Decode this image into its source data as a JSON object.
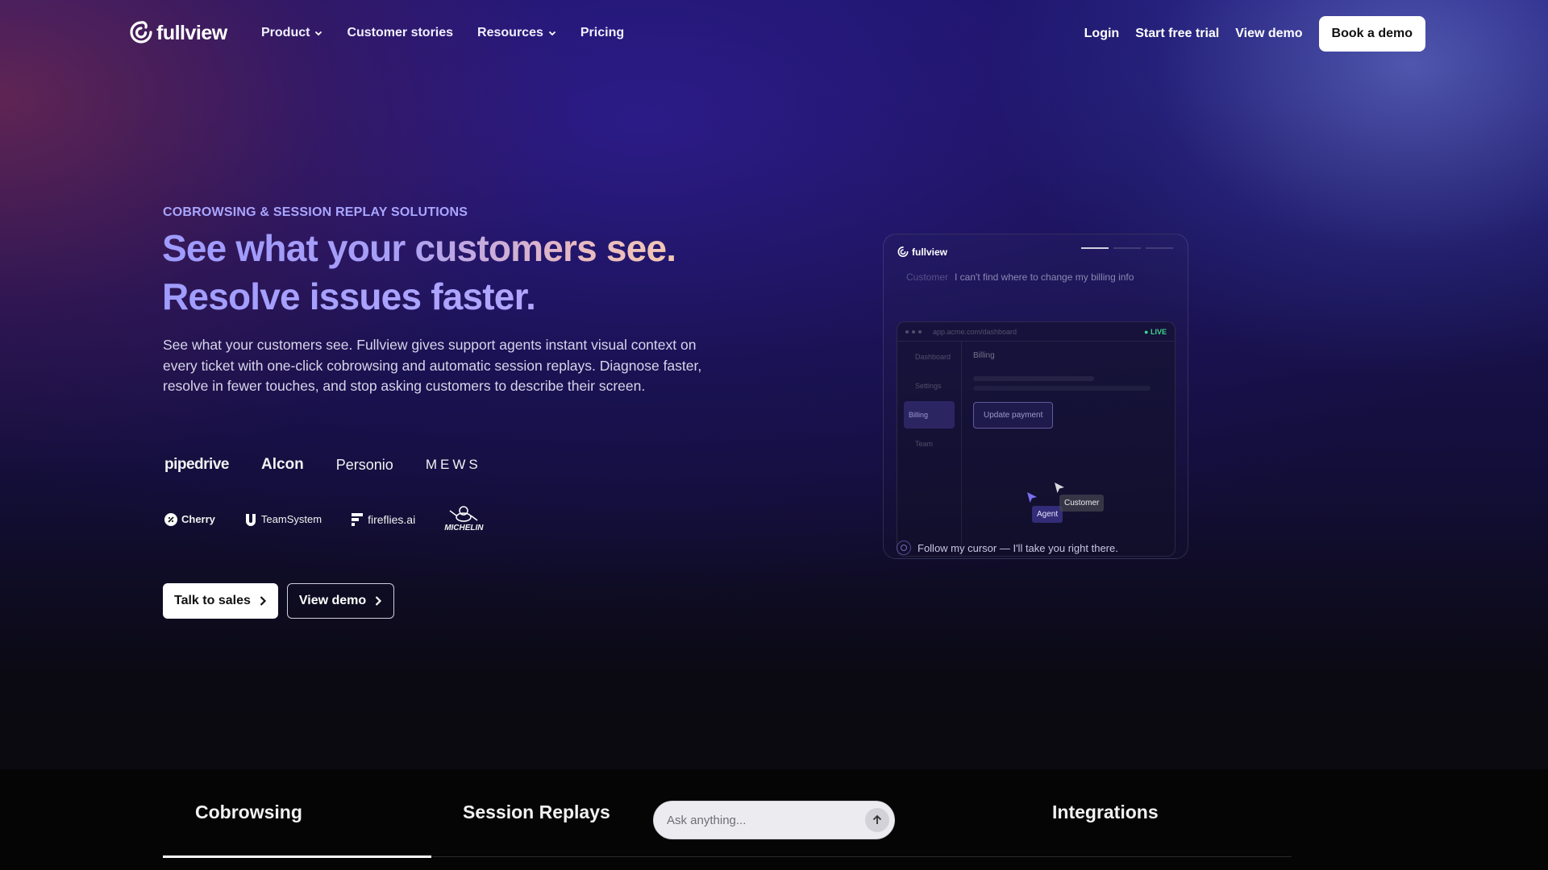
{
  "nav": {
    "brand": "fullview",
    "links": [
      {
        "label": "Product",
        "dropdown": true
      },
      {
        "label": "Customer stories",
        "dropdown": false
      },
      {
        "label": "Resources",
        "dropdown": true
      },
      {
        "label": "Pricing",
        "dropdown": false
      }
    ],
    "login": "Login",
    "trial": "Start free trial",
    "view_demo": "View demo",
    "book_demo": "Book a demo"
  },
  "hero": {
    "eyebrow": "COBROWSING & SESSION REPLAY SOLUTIONS",
    "headline_line1": "See what your customers see.",
    "headline_line2": "Resolve issues faster.",
    "description": "See what your customers see. Fullview gives support agents instant visual context on every ticket with one-click cobrowsing and automatic session replays. Diagnose faster, resolve in fewer touches, and stop asking customers to describe their screen.",
    "logos_row1": [
      "pipedrive",
      "Alcon",
      "Personio",
      "MEWS"
    ],
    "logos_row2": [
      "Cherry",
      "TeamSystem",
      "fireflies.ai",
      "MICHELIN"
    ],
    "cta_primary": "Talk to sales",
    "cta_secondary": "View demo"
  },
  "mock": {
    "brand": "fullview",
    "progress_active_index": 0,
    "customer_label": "Customer",
    "customer_message": "I can't find where to change my billing info",
    "url": "app.acme.com/dashboard",
    "live": "● LIVE",
    "sidebar": [
      "Dashboard",
      "Settings",
      "Billing",
      "Team"
    ],
    "sidebar_active": "Billing",
    "section_title": "Billing",
    "button": "Update payment",
    "agent_tag": "Agent",
    "customer_tag": "Customer",
    "footer": "Follow my cursor — I'll take you right there."
  },
  "tabs": {
    "items": [
      "Cobrowsing",
      "Session Replays",
      "Integrations"
    ],
    "active": "Cobrowsing",
    "ask_placeholder": "Ask anything..."
  },
  "colors": {
    "accent_purple": "#a09cff",
    "headline_peach": "#f4c8b3",
    "live_green": "#3dd68c"
  }
}
